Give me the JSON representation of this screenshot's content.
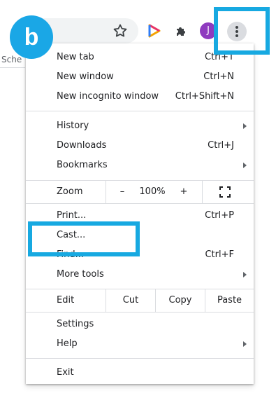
{
  "step_badge": "b",
  "toolbar": {
    "avatar_initial": "J"
  },
  "background_tab_text": "Sche",
  "menu": {
    "group1": [
      {
        "label": "New tab",
        "shortcut": "Ctrl+T"
      },
      {
        "label": "New window",
        "shortcut": "Ctrl+N"
      },
      {
        "label": "New incognito window",
        "shortcut": "Ctrl+Shift+N"
      }
    ],
    "group2": [
      {
        "label": "History",
        "shortcut": "",
        "submenu": true
      },
      {
        "label": "Downloads",
        "shortcut": "Ctrl+J"
      },
      {
        "label": "Bookmarks",
        "shortcut": "",
        "submenu": true
      }
    ],
    "zoom": {
      "label": "Zoom",
      "minus": "–",
      "level": "100%",
      "plus": "+"
    },
    "group3": [
      {
        "label": "Print...",
        "shortcut": "Ctrl+P"
      },
      {
        "label": "Cast...",
        "shortcut": ""
      },
      {
        "label": "Find...",
        "shortcut": "Ctrl+F"
      },
      {
        "label": "More tools",
        "shortcut": "",
        "submenu": true
      }
    ],
    "edit": {
      "label": "Edit",
      "cut": "Cut",
      "copy": "Copy",
      "paste": "Paste"
    },
    "group4": [
      {
        "label": "Settings",
        "shortcut": ""
      },
      {
        "label": "Help",
        "shortcut": "",
        "submenu": true
      }
    ],
    "exit": {
      "label": "Exit"
    }
  },
  "colors": {
    "highlight": "#17a9e1",
    "badge": "#1aa7e6",
    "avatar": "#8e3bbf"
  }
}
